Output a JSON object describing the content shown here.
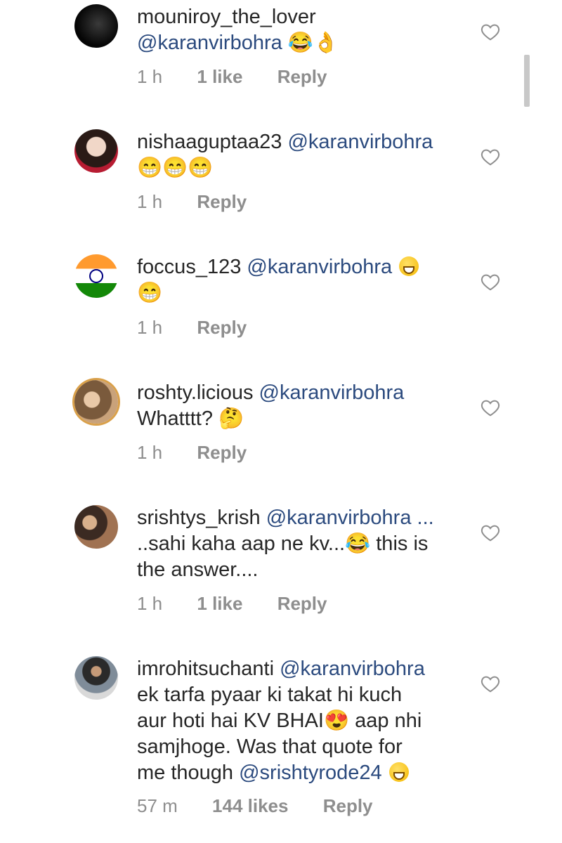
{
  "comments": [
    {
      "username": "mouniroy_the_lover",
      "text_lines": [
        "@karanvirbohra 😂👌"
      ],
      "time": "1 h",
      "likes": "1 like",
      "reply": "Reply"
    },
    {
      "username": "nishaaguptaa23",
      "mention": "@karanvirbohra",
      "line2": "😁😁😁",
      "time": "1 h",
      "reply": "Reply"
    },
    {
      "username": "foccus_123",
      "mention": "@karanvirbohra",
      "line2": "😁",
      "time": "1 h",
      "reply": "Reply"
    },
    {
      "username": "roshty.licious",
      "mention": "@karanvirbohra",
      "line2": "Whatttt? 🤔",
      "time": "1 h",
      "reply": "Reply"
    },
    {
      "username": "srishtys_krish",
      "mention": "@karanvirbohra ...",
      "line2": "..sahi kaha aap ne kv...😂 this is",
      "line3": "the answer....",
      "time": "1 h",
      "likes": "1 like",
      "reply": "Reply"
    },
    {
      "username": "imrohitsuchanti",
      "mention": "@karanvirbohra",
      "line2": "ek tarfa pyaar ki takat hi kuch",
      "line3": "aur hoti hai KV BHAI😍 aap nhi",
      "line4": "samjhoge. Was that quote for",
      "line5_text": "me though",
      "line5_mention": "@srishtyrode24",
      "time": "57 m",
      "likes": "144 likes",
      "reply": "Reply"
    }
  ],
  "icons": {
    "like": "heart-outline-icon",
    "avatar": "profile-avatar"
  },
  "colors": {
    "mention": "#2b4a7e",
    "meta": "#8e8e8e",
    "text": "#262626"
  }
}
